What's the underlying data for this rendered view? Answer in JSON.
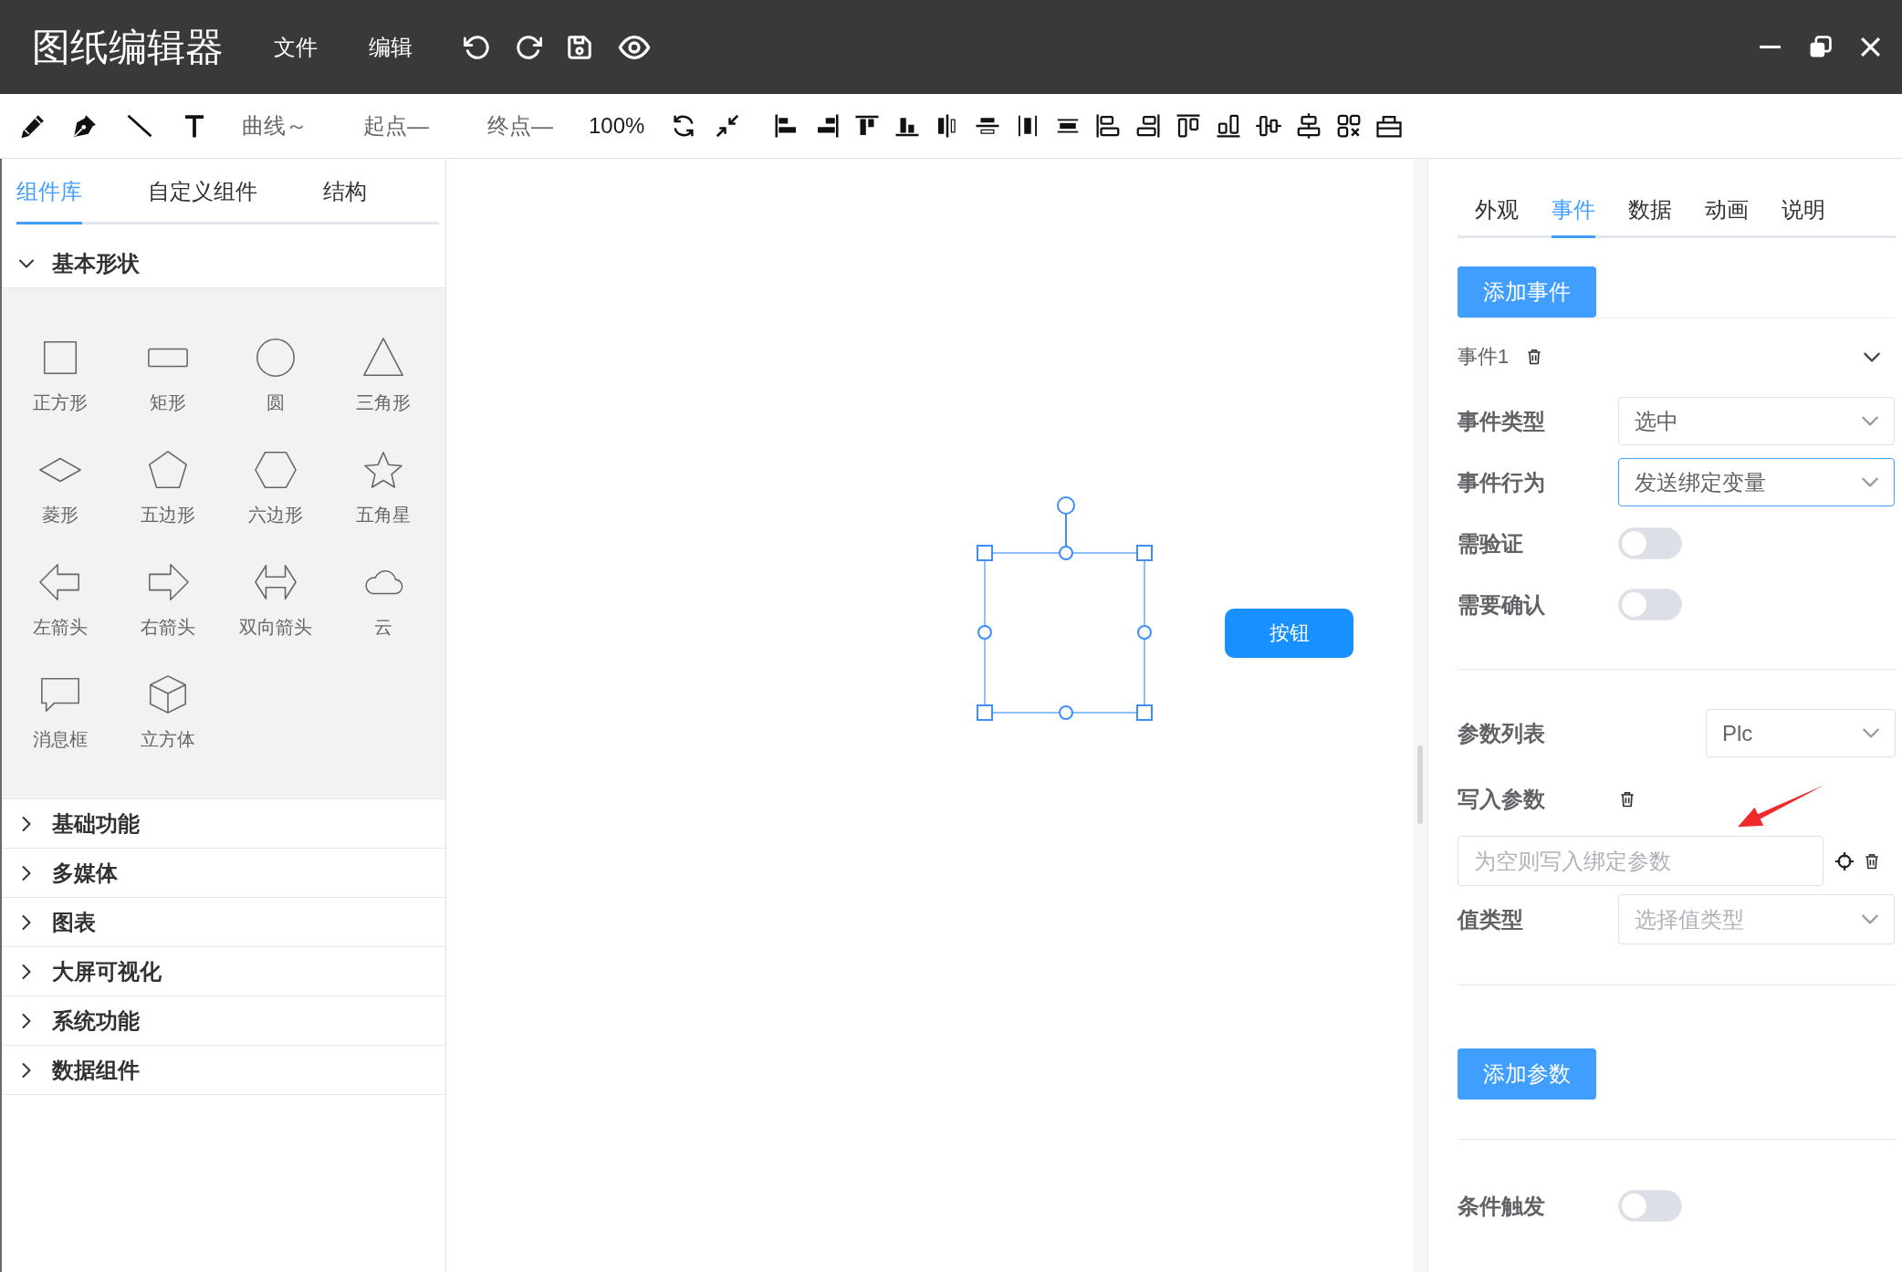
{
  "title_bar": {
    "title": "图纸编辑器",
    "menus": [
      {
        "label": "文件"
      },
      {
        "label": "编辑"
      }
    ]
  },
  "toolbar": {
    "curve": "曲线～",
    "start_point": "起点—",
    "end_point": "终点—",
    "zoom": "100%"
  },
  "component_panel": {
    "tabs": [
      {
        "label": "组件库",
        "selected": true
      },
      {
        "label": "自定义组件",
        "selected": false
      },
      {
        "label": "结构",
        "selected": false
      }
    ],
    "groups": [
      {
        "label": "基本形状",
        "expanded": true,
        "items": [
          {
            "label": "正方形"
          },
          {
            "label": "矩形"
          },
          {
            "label": "圆"
          },
          {
            "label": "三角形"
          },
          {
            "label": "菱形"
          },
          {
            "label": "五边形"
          },
          {
            "label": "六边形"
          },
          {
            "label": "五角星"
          },
          {
            "label": "左箭头"
          },
          {
            "label": "右箭头"
          },
          {
            "label": "双向箭头"
          },
          {
            "label": "云"
          },
          {
            "label": "消息框"
          },
          {
            "label": "立方体"
          }
        ]
      },
      {
        "label": "基础功能",
        "expanded": false
      },
      {
        "label": "多媒体",
        "expanded": false
      },
      {
        "label": "图表",
        "expanded": false
      },
      {
        "label": "大屏可视化",
        "expanded": false
      },
      {
        "label": "系统功能",
        "expanded": false
      },
      {
        "label": "数据组件",
        "expanded": false
      }
    ]
  },
  "canvas": {
    "button": {
      "label": "按钮"
    }
  },
  "properties_panel": {
    "tabs": [
      {
        "label": "外观",
        "selected": false
      },
      {
        "label": "事件",
        "selected": true
      },
      {
        "label": "数据",
        "selected": false
      },
      {
        "label": "动画",
        "selected": false
      },
      {
        "label": "说明",
        "selected": false
      }
    ],
    "add_event_button": "添加事件",
    "events": [
      {
        "title": "事件1",
        "expanded": true,
        "fields": [
          {
            "kind": "select",
            "label": "事件类型",
            "value": "选中",
            "focused": false
          },
          {
            "kind": "select",
            "label": "事件行为",
            "value": "发送绑定变量",
            "focused": true
          },
          {
            "kind": "switch",
            "label": "需验证",
            "on": false
          },
          {
            "kind": "switch",
            "label": "需要确认",
            "on": false
          }
        ],
        "param_list": {
          "label": "参数列表",
          "value": "Plc"
        },
        "write_param": {
          "label": "写入参数",
          "placeholder": "为空则写入绑定参数"
        },
        "value_type": {
          "label": "值类型",
          "placeholder": "选择值类型"
        },
        "add_param_button": "添加参数",
        "condition_trigger": {
          "label": "条件触发",
          "on": false
        }
      }
    ]
  }
}
